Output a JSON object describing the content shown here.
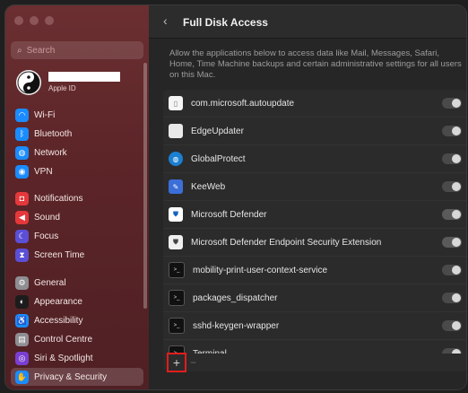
{
  "sidebar": {
    "search_placeholder": "Search",
    "account_label": "Apple ID",
    "items": [
      {
        "label": "Wi-Fi",
        "icon": "wifi-icon",
        "color": "#1a8cff",
        "glyph": "◠"
      },
      {
        "label": "Bluetooth",
        "icon": "bluetooth-icon",
        "color": "#1a8cff",
        "glyph": "ᛒ"
      },
      {
        "label": "Network",
        "icon": "globe-icon",
        "color": "#1a8cff",
        "glyph": "◍"
      },
      {
        "label": "VPN",
        "icon": "vpn-icon",
        "color": "#1a8cff",
        "glyph": "◉"
      },
      {
        "label": "Notifications",
        "icon": "bell-icon",
        "color": "#e5383b",
        "glyph": "◘"
      },
      {
        "label": "Sound",
        "icon": "speaker-icon",
        "color": "#e5383b",
        "glyph": "◀"
      },
      {
        "label": "Focus",
        "icon": "moon-icon",
        "color": "#5b4fd6",
        "glyph": "☾"
      },
      {
        "label": "Screen Time",
        "icon": "hourglass-icon",
        "color": "#5b4fd6",
        "glyph": "⧗"
      },
      {
        "label": "General",
        "icon": "gear-icon",
        "color": "#8e8e93",
        "glyph": "⚙"
      },
      {
        "label": "Appearance",
        "icon": "appearance-icon",
        "color": "#1c1c1c",
        "glyph": "◐"
      },
      {
        "label": "Accessibility",
        "icon": "accessibility-icon",
        "color": "#1a8cff",
        "glyph": "♿"
      },
      {
        "label": "Control Centre",
        "icon": "control-centre-icon",
        "color": "#8e8e93",
        "glyph": "▤"
      },
      {
        "label": "Siri & Spotlight",
        "icon": "siri-icon",
        "color": "#7a3fd1",
        "glyph": "◎"
      },
      {
        "label": "Privacy & Security",
        "icon": "hand-icon",
        "color": "#1a8cff",
        "glyph": "✋"
      }
    ]
  },
  "main": {
    "title": "Full Disk Access",
    "description": "Allow the applications below to access data like Mail, Messages, Safari, Home, Time Machine backups and certain administrative settings for all users on this Mac.",
    "apps": [
      {
        "name": "com.microsoft.autoupdate",
        "icon": "document-icon",
        "on": false
      },
      {
        "name": "EdgeUpdater",
        "icon": "generic-app-icon",
        "on": false
      },
      {
        "name": "GlobalProtect",
        "icon": "globe-icon",
        "on": false
      },
      {
        "name": "KeeWeb",
        "icon": "keeweb-icon",
        "on": false
      },
      {
        "name": "Microsoft Defender",
        "icon": "defender-shield-icon",
        "on": true
      },
      {
        "name": "Microsoft Defender Endpoint Security Extension",
        "icon": "shield-icon",
        "on": true
      },
      {
        "name": "mobility-print-user-context-service",
        "icon": "terminal-icon",
        "on": false
      },
      {
        "name": "packages_dispatcher",
        "icon": "terminal-icon",
        "on": false
      },
      {
        "name": "sshd-keygen-wrapper",
        "icon": "terminal-icon",
        "on": false
      },
      {
        "name": "Terminal",
        "icon": "terminal-icon",
        "on": false
      }
    ],
    "add_label": "+",
    "remove_label": "−"
  }
}
